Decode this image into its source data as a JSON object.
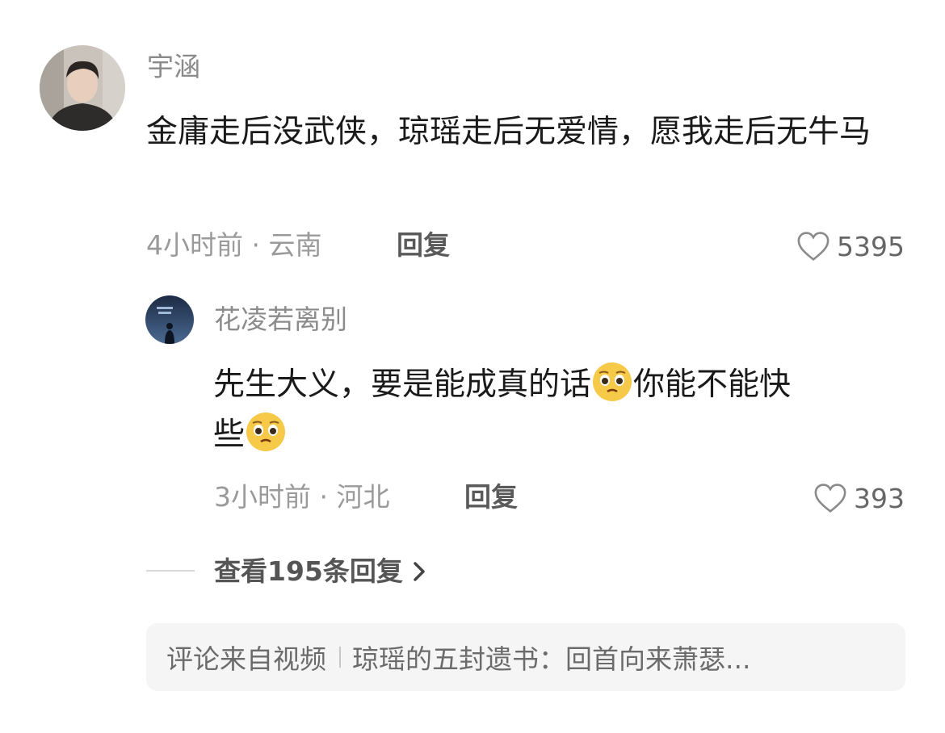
{
  "comments": [
    {
      "username": "宇涵",
      "text": "金庸走后没武侠，琼瑶走后无爱情，愿我走后无牛马",
      "time": "4小时前",
      "location": "云南",
      "reply_label": "回复",
      "likes": "5395",
      "avatar_icon": "man-portrait-avatar"
    },
    {
      "username": "花凌若离别",
      "text_part1": "先生大义，要是能成真的话",
      "text_part2": "你能不能快",
      "text_part3": "些",
      "emoji": "pleading-face-emoji",
      "time": "3小时前",
      "location": "河北",
      "reply_label": "回复",
      "likes": "393",
      "avatar_icon": "night-silhouette-avatar"
    }
  ],
  "view_replies": {
    "label": "查看195条回复"
  },
  "source": {
    "prefix": "评论来自视频",
    "title": "琼瑶的五封遗书：回首向来萧瑟..."
  }
}
